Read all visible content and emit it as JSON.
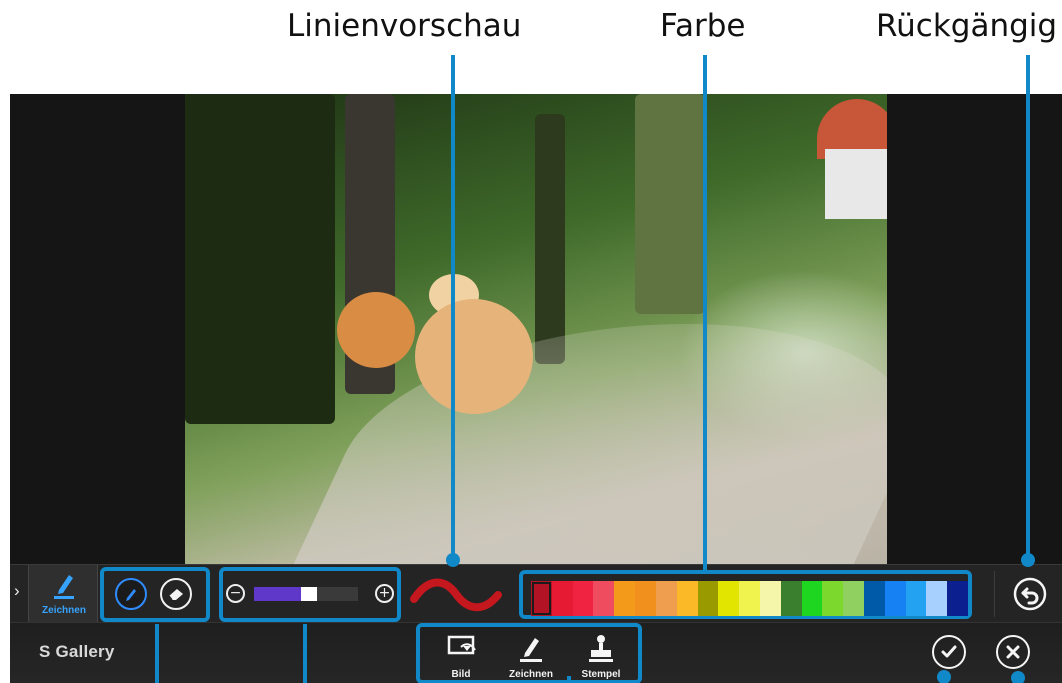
{
  "callouts": {
    "line_preview": "Linienvorschau",
    "color": "Farbe",
    "undo": "Rückgängig"
  },
  "toolbar": {
    "expand_icon": "chevron-right-icon",
    "draw_tab_label": "Zeichnen",
    "pen_icon": "pen-icon",
    "eraser_icon": "eraser-icon",
    "size_minus_icon": "minus-circle-icon",
    "size_plus_icon": "plus-circle-icon",
    "pen_size_level": 0.45,
    "line_color": "#c4171e",
    "undo_icon": "undo-icon",
    "palette": [
      "#b31425",
      "#e61a32",
      "#f02440",
      "#f04c60",
      "#f39a1a",
      "#f1901d",
      "#ef9d4f",
      "#fbb928",
      "#999900",
      "#e1e500",
      "#f0f24d",
      "#f5f6aa",
      "#3a7f2e",
      "#1ed620",
      "#7dd82e",
      "#90d060",
      "#005aa8",
      "#1681f2",
      "#22a2f0",
      "#a8d0ff",
      "#0b1f8f"
    ],
    "selected_color_index": 0
  },
  "bottom_bar": {
    "app_name": "S Gallery",
    "modes": [
      {
        "label": "Bild",
        "icon": "image-frame-icon"
      },
      {
        "label": "Zeichnen",
        "icon": "pen-draw-icon"
      },
      {
        "label": "Stempel",
        "icon": "stamp-icon"
      }
    ],
    "ok_icon": "check-icon",
    "cancel_icon": "close-icon"
  },
  "colors": {
    "accent": "#1189c8",
    "toolbar_bg": "#242424",
    "active_blue": "#2f8cff"
  }
}
